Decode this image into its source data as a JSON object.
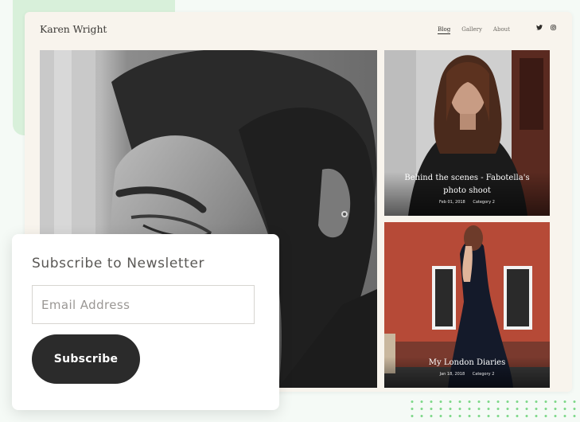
{
  "site": {
    "brand": "Karen Wright"
  },
  "nav": {
    "items": [
      {
        "label": "Blog",
        "active": true
      },
      {
        "label": "Gallery",
        "active": false
      },
      {
        "label": "About",
        "active": false
      }
    ],
    "social": [
      "twitter-icon",
      "instagram-icon"
    ]
  },
  "posts": [
    {
      "title": "Behind the scenes - Fabotella's photo shoot",
      "date": "Feb 01, 2018",
      "category": "Category 2"
    },
    {
      "title": "My London Diaries",
      "date": "Jan 18, 2018",
      "category": "Category 2"
    }
  ],
  "newsletter": {
    "title": "Subscribe to Newsletter",
    "email_placeholder": "Email Address",
    "button_label": "Subscribe"
  },
  "colors": {
    "accent_green": "#d8f0da",
    "dot_green": "#7fd88a",
    "button_dark": "#2b2b2b",
    "card_bg": "#f8f4ed"
  }
}
